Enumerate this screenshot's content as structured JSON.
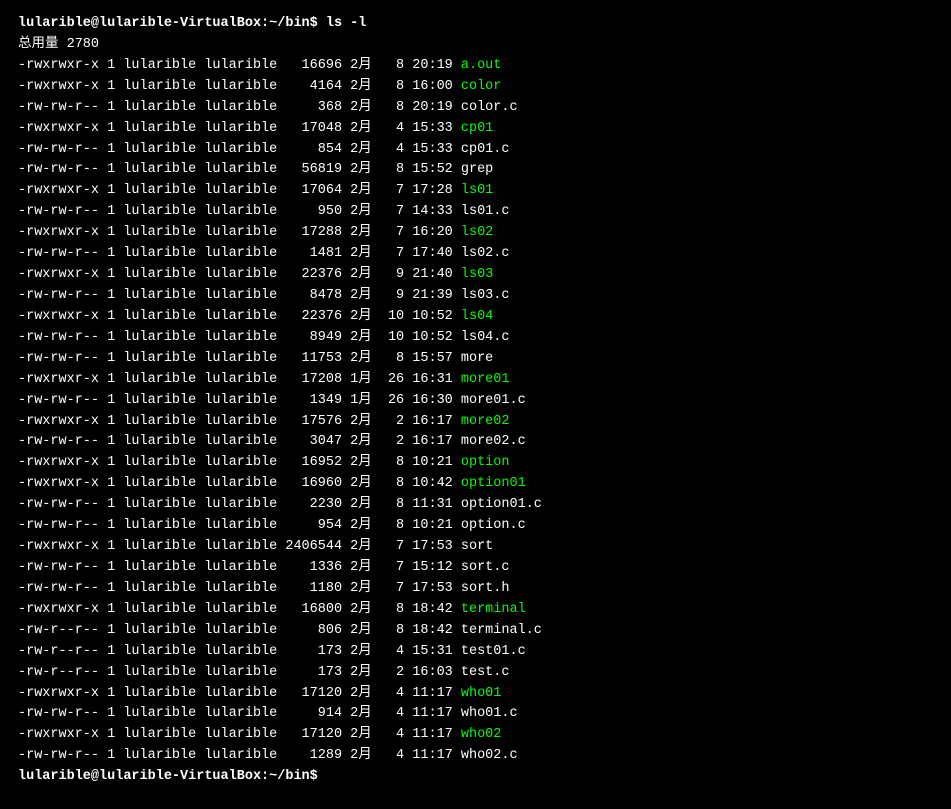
{
  "terminal": {
    "prompt_top": "lularible@lularible-VirtualBox:~/bin$ ls -l",
    "total_line": "总用量 2780",
    "prompt_bottom": "lularible@lularible-VirtualBox:~/bin$",
    "files": [
      {
        "perms": "-rwxrwxr-x",
        "links": "1",
        "user": "lularible",
        "group": "lularible",
        "size": "16696",
        "month": "2月",
        "day": "8",
        "time": "20:19",
        "name": "a.out",
        "executable": true
      },
      {
        "perms": "-rwxrwxr-x",
        "links": "1",
        "user": "lularible",
        "group": "lularible",
        "size": "4164",
        "month": "2月",
        "day": "8",
        "time": "16:00",
        "name": "color",
        "executable": true
      },
      {
        "perms": "-rw-rw-r--",
        "links": "1",
        "user": "lularible",
        "group": "lularible",
        "size": "368",
        "month": "2月",
        "day": "8",
        "time": "20:19",
        "name": "color.c",
        "executable": false
      },
      {
        "perms": "-rwxrwxr-x",
        "links": "1",
        "user": "lularible",
        "group": "lularible",
        "size": "17048",
        "month": "2月",
        "day": "4",
        "time": "15:33",
        "name": "cp01",
        "executable": true
      },
      {
        "perms": "-rw-rw-r--",
        "links": "1",
        "user": "lularible",
        "group": "lularible",
        "size": "854",
        "month": "2月",
        "day": "4",
        "time": "15:33",
        "name": "cp01.c",
        "executable": false
      },
      {
        "perms": "-rw-rw-r--",
        "links": "1",
        "user": "lularible",
        "group": "lularible",
        "size": "56819",
        "month": "2月",
        "day": "8",
        "time": "15:52",
        "name": "grep",
        "executable": false
      },
      {
        "perms": "-rwxrwxr-x",
        "links": "1",
        "user": "lularible",
        "group": "lularible",
        "size": "17064",
        "month": "2月",
        "day": "7",
        "time": "17:28",
        "name": "ls01",
        "executable": true
      },
      {
        "perms": "-rw-rw-r--",
        "links": "1",
        "user": "lularible",
        "group": "lularible",
        "size": "950",
        "month": "2月",
        "day": "7",
        "time": "14:33",
        "name": "ls01.c",
        "executable": false
      },
      {
        "perms": "-rwxrwxr-x",
        "links": "1",
        "user": "lularible",
        "group": "lularible",
        "size": "17288",
        "month": "2月",
        "day": "7",
        "time": "16:20",
        "name": "ls02",
        "executable": true
      },
      {
        "perms": "-rw-rw-r--",
        "links": "1",
        "user": "lularible",
        "group": "lularible",
        "size": "1481",
        "month": "2月",
        "day": "7",
        "time": "17:40",
        "name": "ls02.c",
        "executable": false
      },
      {
        "perms": "-rwxrwxr-x",
        "links": "1",
        "user": "lularible",
        "group": "lularible",
        "size": "22376",
        "month": "2月",
        "day": "9",
        "time": "21:40",
        "name": "ls03",
        "executable": true
      },
      {
        "perms": "-rw-rw-r--",
        "links": "1",
        "user": "lularible",
        "group": "lularible",
        "size": "8478",
        "month": "2月",
        "day": "9",
        "time": "21:39",
        "name": "ls03.c",
        "executable": false
      },
      {
        "perms": "-rwxrwxr-x",
        "links": "1",
        "user": "lularible",
        "group": "lularible",
        "size": "22376",
        "month": "2月",
        "day": "10",
        "time": "10:52",
        "name": "ls04",
        "executable": true
      },
      {
        "perms": "-rw-rw-r--",
        "links": "1",
        "user": "lularible",
        "group": "lularible",
        "size": "8949",
        "month": "2月",
        "day": "10",
        "time": "10:52",
        "name": "ls04.c",
        "executable": false
      },
      {
        "perms": "-rw-rw-r--",
        "links": "1",
        "user": "lularible",
        "group": "lularible",
        "size": "11753",
        "month": "2月",
        "day": "8",
        "time": "15:57",
        "name": "more",
        "executable": false
      },
      {
        "perms": "-rwxrwxr-x",
        "links": "1",
        "user": "lularible",
        "group": "lularible",
        "size": "17208",
        "month": "1月",
        "day": "26",
        "time": "16:31",
        "name": "more01",
        "executable": true
      },
      {
        "perms": "-rw-rw-r--",
        "links": "1",
        "user": "lularible",
        "group": "lularible",
        "size": "1349",
        "month": "1月",
        "day": "26",
        "time": "16:30",
        "name": "more01.c",
        "executable": false
      },
      {
        "perms": "-rwxrwxr-x",
        "links": "1",
        "user": "lularible",
        "group": "lularible",
        "size": "17576",
        "month": "2月",
        "day": "2",
        "time": "16:17",
        "name": "more02",
        "executable": true
      },
      {
        "perms": "-rw-rw-r--",
        "links": "1",
        "user": "lularible",
        "group": "lularible",
        "size": "3047",
        "month": "2月",
        "day": "2",
        "time": "16:17",
        "name": "more02.c",
        "executable": false
      },
      {
        "perms": "-rwxrwxr-x",
        "links": "1",
        "user": "lularible",
        "group": "lularible",
        "size": "16952",
        "month": "2月",
        "day": "8",
        "time": "10:21",
        "name": "option",
        "executable": true
      },
      {
        "perms": "-rwxrwxr-x",
        "links": "1",
        "user": "lularible",
        "group": "lularible",
        "size": "16960",
        "month": "2月",
        "day": "8",
        "time": "10:42",
        "name": "option01",
        "executable": true
      },
      {
        "perms": "-rw-rw-r--",
        "links": "1",
        "user": "lularible",
        "group": "lularible",
        "size": "2230",
        "month": "2月",
        "day": "8",
        "time": "11:31",
        "name": "option01.c",
        "executable": false
      },
      {
        "perms": "-rw-rw-r--",
        "links": "1",
        "user": "lularible",
        "group": "lularible",
        "size": "954",
        "month": "2月",
        "day": "8",
        "time": "10:21",
        "name": "option.c",
        "executable": false
      },
      {
        "perms": "-rwxrwxr-x",
        "links": "1",
        "user": "lularible",
        "group": "lularible",
        "size": "2406544",
        "month": "2月",
        "day": "7",
        "time": "17:53",
        "name": "sort",
        "executable": false
      },
      {
        "perms": "-rw-rw-r--",
        "links": "1",
        "user": "lularible",
        "group": "lularible",
        "size": "1336",
        "month": "2月",
        "day": "7",
        "time": "15:12",
        "name": "sort.c",
        "executable": false
      },
      {
        "perms": "-rw-rw-r--",
        "links": "1",
        "user": "lularible",
        "group": "lularible",
        "size": "1180",
        "month": "2月",
        "day": "7",
        "time": "17:53",
        "name": "sort.h",
        "executable": false
      },
      {
        "perms": "-rwxrwxr-x",
        "links": "1",
        "user": "lularible",
        "group": "lularible",
        "size": "16800",
        "month": "2月",
        "day": "8",
        "time": "18:42",
        "name": "terminal",
        "executable": true
      },
      {
        "perms": "-rw-r--r--",
        "links": "1",
        "user": "lularible",
        "group": "lularible",
        "size": "806",
        "month": "2月",
        "day": "8",
        "time": "18:42",
        "name": "terminal.c",
        "executable": false
      },
      {
        "perms": "-rw-r--r--",
        "links": "1",
        "user": "lularible",
        "group": "lularible",
        "size": "173",
        "month": "2月",
        "day": "4",
        "time": "15:31",
        "name": "test01.c",
        "executable": false
      },
      {
        "perms": "-rw-r--r--",
        "links": "1",
        "user": "lularible",
        "group": "lularible",
        "size": "173",
        "month": "2月",
        "day": "2",
        "time": "16:03",
        "name": "test.c",
        "executable": false
      },
      {
        "perms": "-rwxrwxr-x",
        "links": "1",
        "user": "lularible",
        "group": "lularible",
        "size": "17120",
        "month": "2月",
        "day": "4",
        "time": "11:17",
        "name": "who01",
        "executable": true
      },
      {
        "perms": "-rw-rw-r--",
        "links": "1",
        "user": "lularible",
        "group": "lularible",
        "size": "914",
        "month": "2月",
        "day": "4",
        "time": "11:17",
        "name": "who01.c",
        "executable": false
      },
      {
        "perms": "-rwxrwxr-x",
        "links": "1",
        "user": "lularible",
        "group": "lularible",
        "size": "17120",
        "month": "2月",
        "day": "4",
        "time": "11:17",
        "name": "who02",
        "executable": true
      },
      {
        "perms": "-rw-rw-r--",
        "links": "1",
        "user": "lularible",
        "group": "lularible",
        "size": "1289",
        "month": "2月",
        "day": "4",
        "time": "11:17",
        "name": "who02.c",
        "executable": false
      }
    ]
  }
}
